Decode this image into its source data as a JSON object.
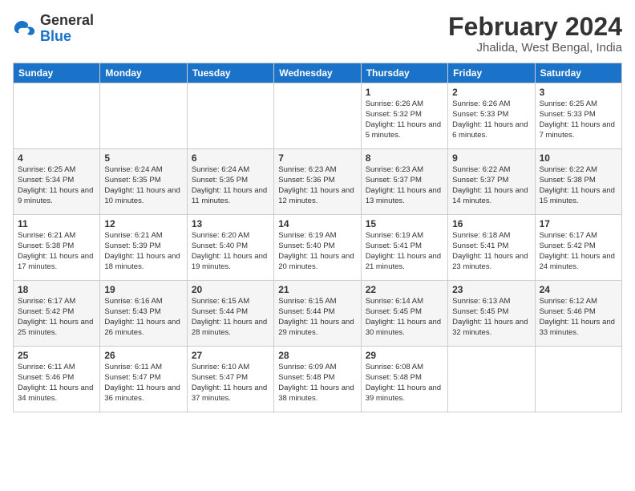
{
  "header": {
    "logo_line1": "General",
    "logo_line2": "Blue",
    "main_title": "February 2024",
    "subtitle": "Jhalida, West Bengal, India"
  },
  "weekdays": [
    "Sunday",
    "Monday",
    "Tuesday",
    "Wednesday",
    "Thursday",
    "Friday",
    "Saturday"
  ],
  "weeks": [
    [
      {
        "day": "",
        "info": ""
      },
      {
        "day": "",
        "info": ""
      },
      {
        "day": "",
        "info": ""
      },
      {
        "day": "",
        "info": ""
      },
      {
        "day": "1",
        "info": "Sunrise: 6:26 AM\nSunset: 5:32 PM\nDaylight: 11 hours\nand 5 minutes."
      },
      {
        "day": "2",
        "info": "Sunrise: 6:26 AM\nSunset: 5:33 PM\nDaylight: 11 hours\nand 6 minutes."
      },
      {
        "day": "3",
        "info": "Sunrise: 6:25 AM\nSunset: 5:33 PM\nDaylight: 11 hours\nand 7 minutes."
      }
    ],
    [
      {
        "day": "4",
        "info": "Sunrise: 6:25 AM\nSunset: 5:34 PM\nDaylight: 11 hours\nand 9 minutes."
      },
      {
        "day": "5",
        "info": "Sunrise: 6:24 AM\nSunset: 5:35 PM\nDaylight: 11 hours\nand 10 minutes."
      },
      {
        "day": "6",
        "info": "Sunrise: 6:24 AM\nSunset: 5:35 PM\nDaylight: 11 hours\nand 11 minutes."
      },
      {
        "day": "7",
        "info": "Sunrise: 6:23 AM\nSunset: 5:36 PM\nDaylight: 11 hours\nand 12 minutes."
      },
      {
        "day": "8",
        "info": "Sunrise: 6:23 AM\nSunset: 5:37 PM\nDaylight: 11 hours\nand 13 minutes."
      },
      {
        "day": "9",
        "info": "Sunrise: 6:22 AM\nSunset: 5:37 PM\nDaylight: 11 hours\nand 14 minutes."
      },
      {
        "day": "10",
        "info": "Sunrise: 6:22 AM\nSunset: 5:38 PM\nDaylight: 11 hours\nand 15 minutes."
      }
    ],
    [
      {
        "day": "11",
        "info": "Sunrise: 6:21 AM\nSunset: 5:38 PM\nDaylight: 11 hours\nand 17 minutes."
      },
      {
        "day": "12",
        "info": "Sunrise: 6:21 AM\nSunset: 5:39 PM\nDaylight: 11 hours\nand 18 minutes."
      },
      {
        "day": "13",
        "info": "Sunrise: 6:20 AM\nSunset: 5:40 PM\nDaylight: 11 hours\nand 19 minutes."
      },
      {
        "day": "14",
        "info": "Sunrise: 6:19 AM\nSunset: 5:40 PM\nDaylight: 11 hours\nand 20 minutes."
      },
      {
        "day": "15",
        "info": "Sunrise: 6:19 AM\nSunset: 5:41 PM\nDaylight: 11 hours\nand 21 minutes."
      },
      {
        "day": "16",
        "info": "Sunrise: 6:18 AM\nSunset: 5:41 PM\nDaylight: 11 hours\nand 23 minutes."
      },
      {
        "day": "17",
        "info": "Sunrise: 6:17 AM\nSunset: 5:42 PM\nDaylight: 11 hours\nand 24 minutes."
      }
    ],
    [
      {
        "day": "18",
        "info": "Sunrise: 6:17 AM\nSunset: 5:42 PM\nDaylight: 11 hours\nand 25 minutes."
      },
      {
        "day": "19",
        "info": "Sunrise: 6:16 AM\nSunset: 5:43 PM\nDaylight: 11 hours\nand 26 minutes."
      },
      {
        "day": "20",
        "info": "Sunrise: 6:15 AM\nSunset: 5:44 PM\nDaylight: 11 hours\nand 28 minutes."
      },
      {
        "day": "21",
        "info": "Sunrise: 6:15 AM\nSunset: 5:44 PM\nDaylight: 11 hours\nand 29 minutes."
      },
      {
        "day": "22",
        "info": "Sunrise: 6:14 AM\nSunset: 5:45 PM\nDaylight: 11 hours\nand 30 minutes."
      },
      {
        "day": "23",
        "info": "Sunrise: 6:13 AM\nSunset: 5:45 PM\nDaylight: 11 hours\nand 32 minutes."
      },
      {
        "day": "24",
        "info": "Sunrise: 6:12 AM\nSunset: 5:46 PM\nDaylight: 11 hours\nand 33 minutes."
      }
    ],
    [
      {
        "day": "25",
        "info": "Sunrise: 6:11 AM\nSunset: 5:46 PM\nDaylight: 11 hours\nand 34 minutes."
      },
      {
        "day": "26",
        "info": "Sunrise: 6:11 AM\nSunset: 5:47 PM\nDaylight: 11 hours\nand 36 minutes."
      },
      {
        "day": "27",
        "info": "Sunrise: 6:10 AM\nSunset: 5:47 PM\nDaylight: 11 hours\nand 37 minutes."
      },
      {
        "day": "28",
        "info": "Sunrise: 6:09 AM\nSunset: 5:48 PM\nDaylight: 11 hours\nand 38 minutes."
      },
      {
        "day": "29",
        "info": "Sunrise: 6:08 AM\nSunset: 5:48 PM\nDaylight: 11 hours\nand 39 minutes."
      },
      {
        "day": "",
        "info": ""
      },
      {
        "day": "",
        "info": ""
      }
    ]
  ]
}
